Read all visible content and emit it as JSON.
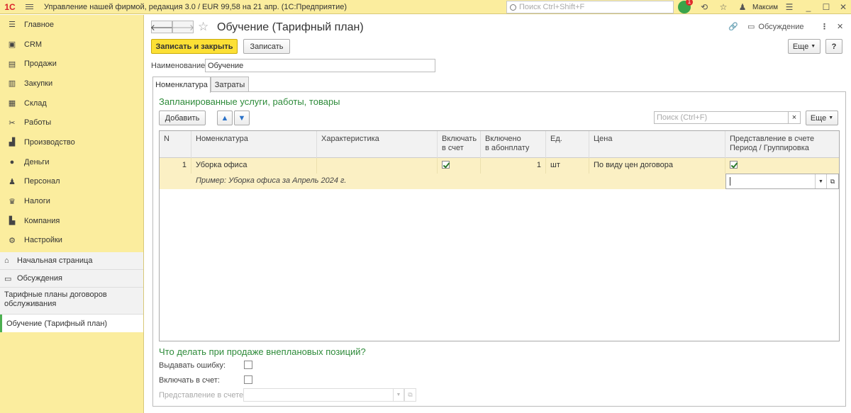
{
  "topbar": {
    "logo": "1С",
    "app_title": "Управление нашей фирмой, редакция 3.0 / EUR 99,58 на 21 апр.  (1С:Предприятие)",
    "search_placeholder": "Поиск Ctrl+Shift+F",
    "notifications_count": "1",
    "user_name": "Максим"
  },
  "sidebar": {
    "items": [
      {
        "label": "Главное",
        "icon": "menu-icon"
      },
      {
        "label": "CRM",
        "icon": "crm-icon"
      },
      {
        "label": "Продажи",
        "icon": "cart-icon"
      },
      {
        "label": "Закупки",
        "icon": "truck-icon"
      },
      {
        "label": "Склад",
        "icon": "warehouse-icon"
      },
      {
        "label": "Работы",
        "icon": "tools-icon"
      },
      {
        "label": "Производство",
        "icon": "factory-icon"
      },
      {
        "label": "Деньги",
        "icon": "money-icon"
      },
      {
        "label": "Персонал",
        "icon": "people-icon"
      },
      {
        "label": "Налоги",
        "icon": "taxes-icon"
      },
      {
        "label": "Компания",
        "icon": "company-icon"
      },
      {
        "label": "Настройки",
        "icon": "gear-icon"
      }
    ],
    "home": "Начальная страница",
    "discussions": "Обсуждения",
    "open_window_1": "Тарифные планы договоров обслуживания",
    "open_window_2": "Обучение (Тарифный план)"
  },
  "form": {
    "title": "Обучение (Тарифный план)",
    "discussion_label": "Обсуждение",
    "save_close_label": "Записать и закрыть",
    "save_label": "Записать",
    "more_label": "Еще",
    "help_label": "?",
    "name_label": "Наименование:",
    "name_value": "Обучение",
    "tabs": [
      "Номенклатура",
      "Затраты"
    ]
  },
  "nomenclature": {
    "section_title": "Запланированные услуги, работы, товары",
    "add_label": "Добавить",
    "search_placeholder": "Поиск (Ctrl+F)",
    "clear_label": "×",
    "more_label": "Еще",
    "columns": {
      "n": "N",
      "item": "Номенклатура",
      "char": "Характеристика",
      "include_1": "Включать",
      "include_2": "в счет",
      "included_1": "Включено",
      "included_2": "в абонплату",
      "unit": "Ед.",
      "price": "Цена",
      "repr_1": "Представление в счете",
      "repr_2": "Период / Группировка"
    },
    "rows": [
      {
        "n": "1",
        "item": "Уборка офиса",
        "characteristic": "",
        "include_in_invoice": true,
        "included": "1",
        "unit": "шт",
        "price": "По виду цен договора",
        "representation": true
      }
    ],
    "example_text": "Пример: Уборка офиса за Апрель 2024 г."
  },
  "unplanned": {
    "title": "Что делать при продаже внеплановых позиций?",
    "error_label": "Выдавать ошибку:",
    "error_checked": false,
    "include_label": "Включать в счет:",
    "include_checked": false,
    "repr_label": "Представление в счете:",
    "repr_value": ""
  }
}
